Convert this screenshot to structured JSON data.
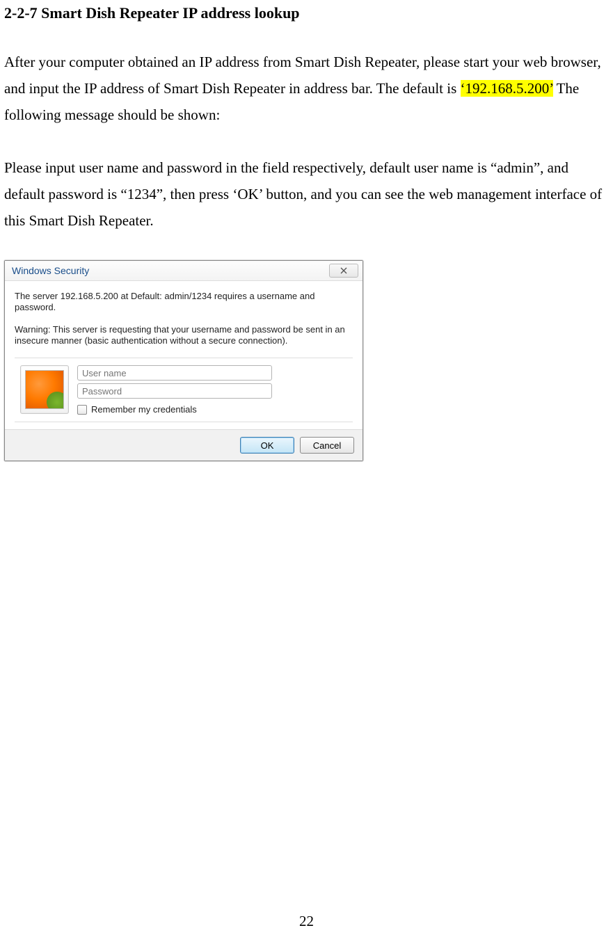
{
  "heading": "2-2-7 Smart Dish Repeater IP address lookup",
  "para1_a": "After your computer obtained an IP address from Smart Dish Repeater, please start your web browser, and input the IP address of Smart Dish Repeater in address bar.    The default is ",
  "para1_hl": "‘192.168.5.200’",
  "para1_b": " The following message should be shown:",
  "para2": "Please input user name and password in the field respectively, default user name is “admin”, and default password is “1234”, then press ‘OK’ button, and you can see the web management interface of this Smart Dish Repeater.",
  "dialog": {
    "title": "Windows Security",
    "msg1": "The server 192.168.5.200 at Default: admin/1234 requires a username and password.",
    "msg2": "Warning: This server is requesting that your username and password be sent in an insecure manner (basic authentication without a secure connection).",
    "username_placeholder": "User name",
    "password_placeholder": "Password",
    "remember": "Remember my credentials",
    "ok": "OK",
    "cancel": "Cancel"
  },
  "page_number": "22"
}
